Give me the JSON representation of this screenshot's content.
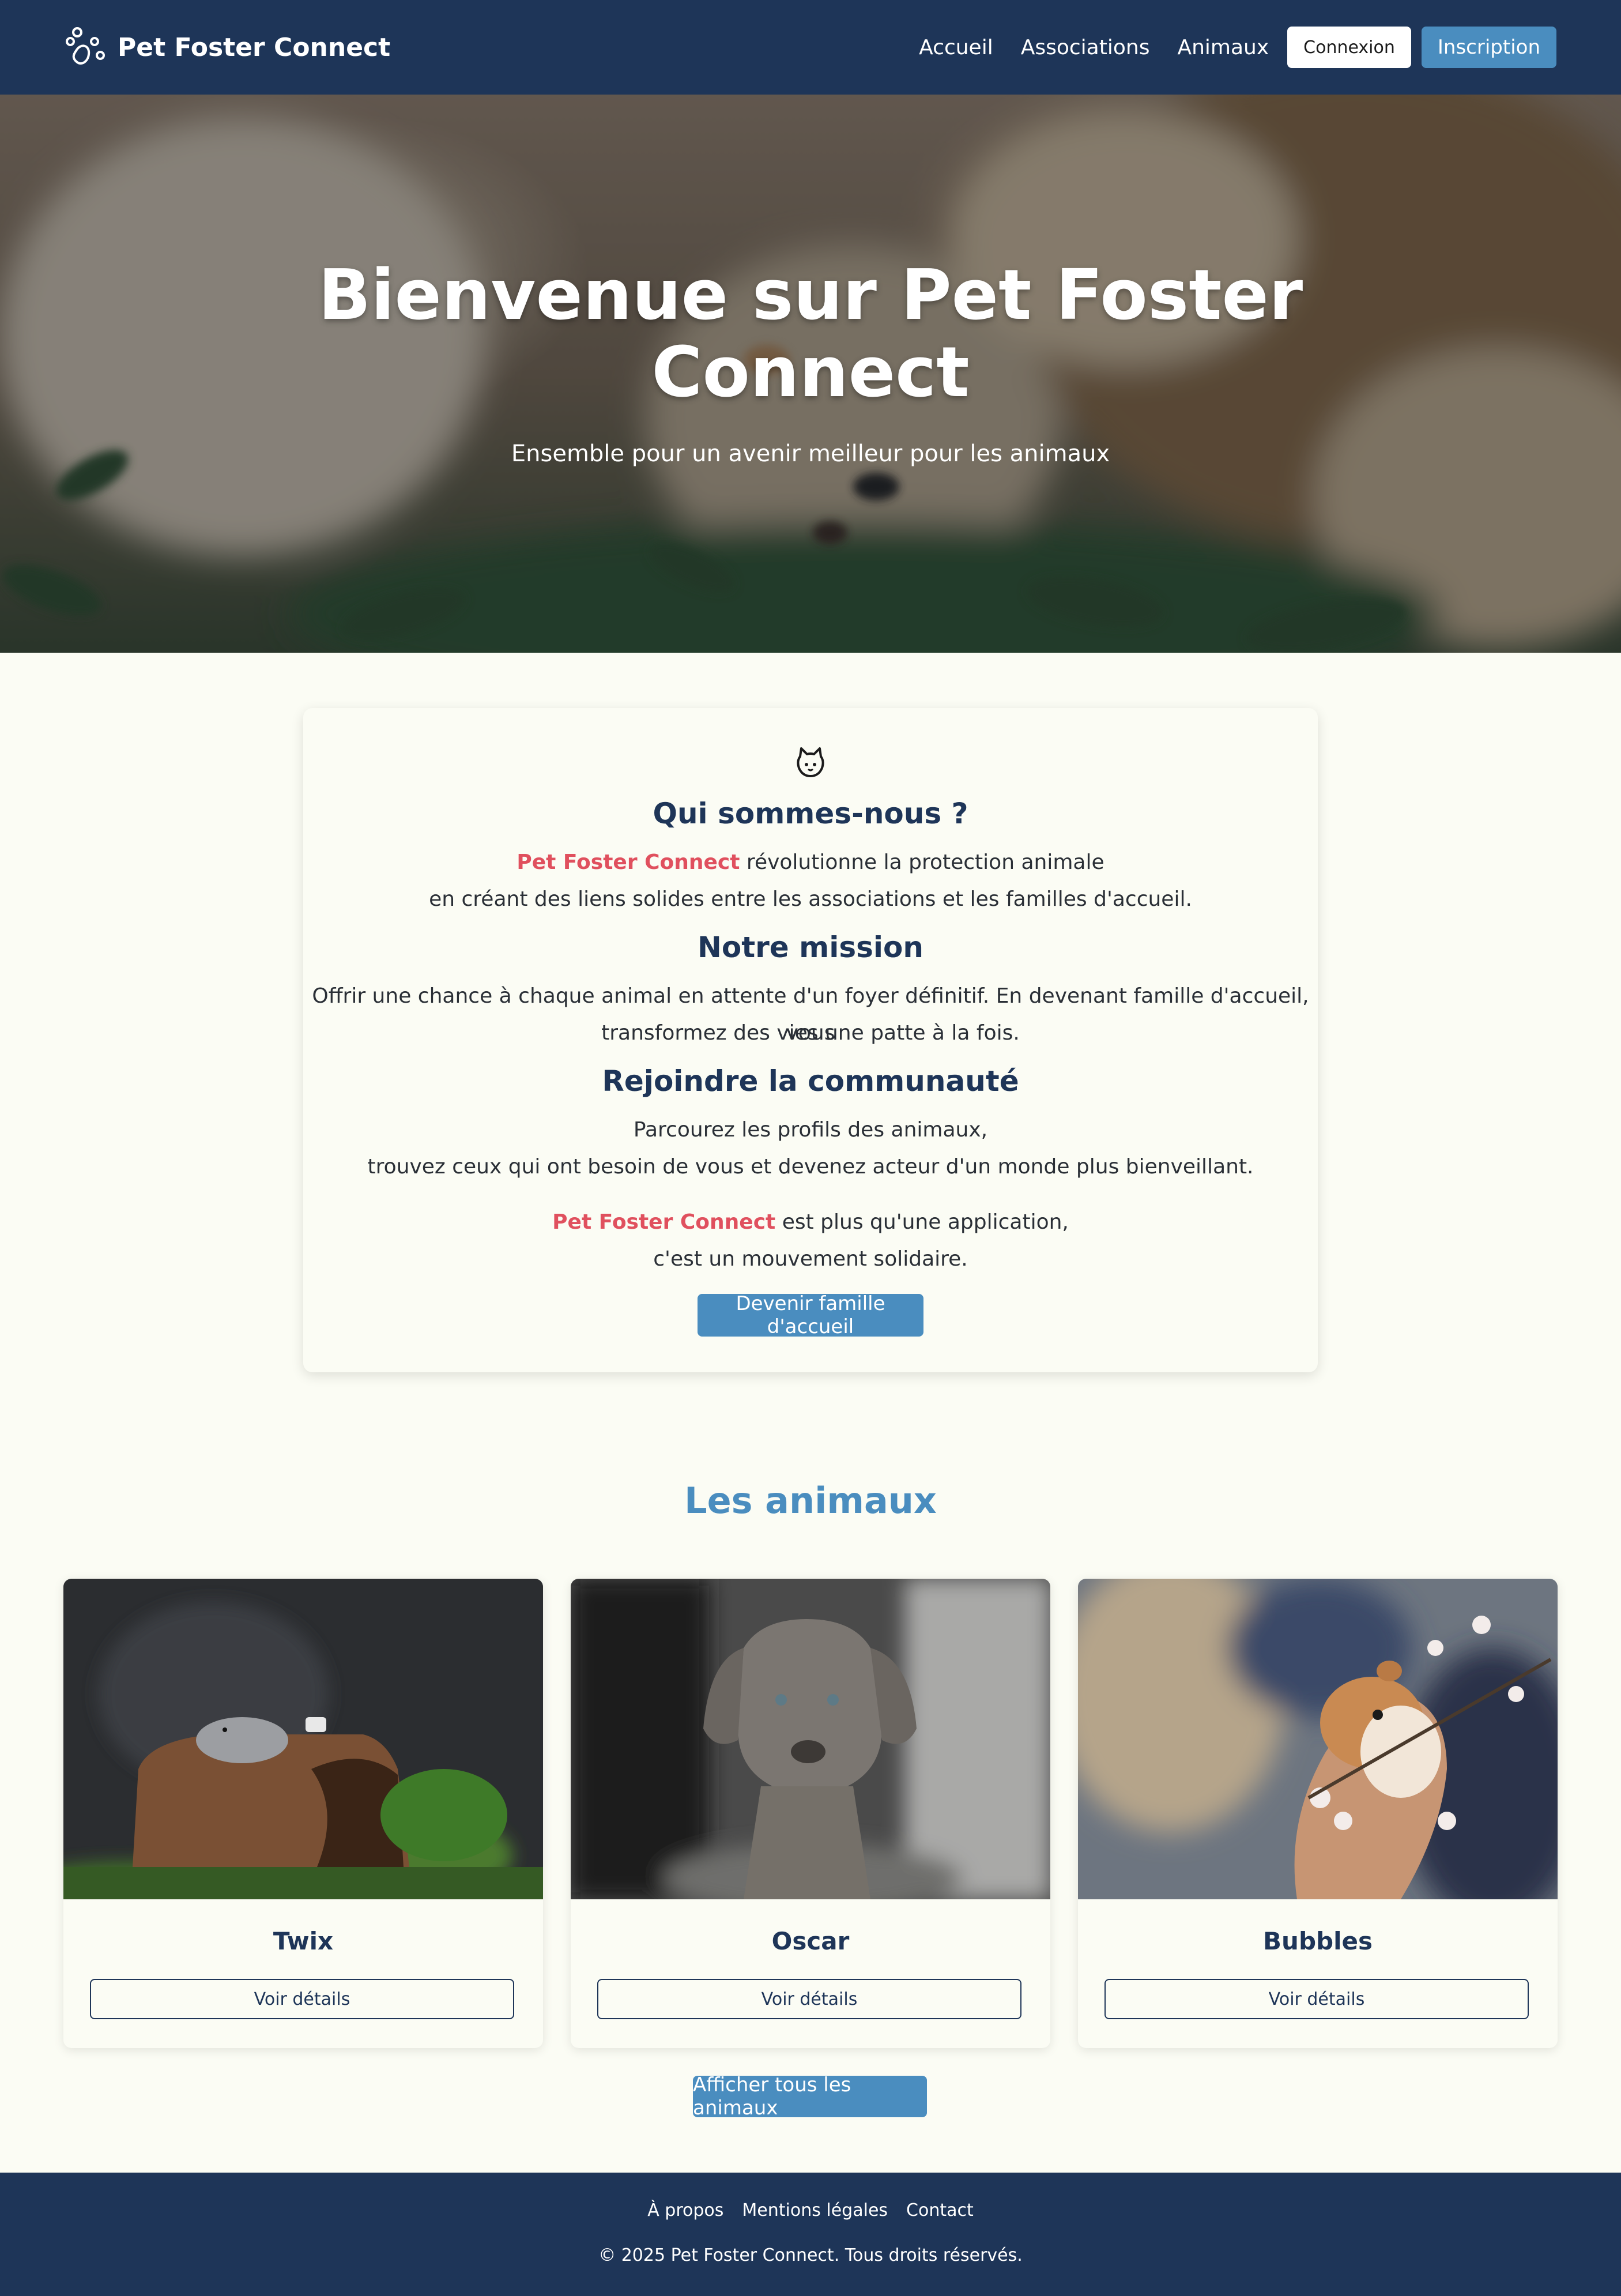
{
  "navbar": {
    "brand": "Pet Foster Connect",
    "brand_icon": "paw-icon",
    "links": [
      "Accueil",
      "Associations",
      "Animaux"
    ],
    "login_label": "Connexion",
    "signup_label": "Inscription"
  },
  "hero": {
    "title_line1": "Bienvenue sur Pet Foster",
    "title_line2": "Connect",
    "subtitle": "Ensemble pour un avenir meilleur pour les animaux"
  },
  "about": {
    "icon": "cat-icon",
    "who_title": "Qui sommes-nous ?",
    "who_brand": "Pet Foster Connect",
    "who_line1_rest": " révolutionne la protection animale",
    "who_line2": "en créant des liens solides entre les associations et les familles d'accueil.",
    "mission_title": "Notre mission",
    "mission_line1": "Offrir une chance à chaque animal en attente d'un foyer définitif. En devenant famille d'accueil, vous",
    "mission_line2": "transformez des vies une patte à la fois.",
    "community_title": "Rejoindre la communauté",
    "community_line1": "Parcourez les profils des animaux,",
    "community_line2": "trouvez ceux qui ont besoin de vous et devenez acteur d'un monde plus bienveillant.",
    "closing_brand": "Pet Foster Connect",
    "closing_line1_rest": " est plus qu'une application,",
    "closing_line2": "c'est un mouvement solidaire.",
    "cta_label": "Devenir famille d'accueil"
  },
  "animals": {
    "title": "Les animaux",
    "items": [
      {
        "name": "Twix",
        "button": "Voir détails"
      },
      {
        "name": "Oscar",
        "button": "Voir détails"
      },
      {
        "name": "Bubbles",
        "button": "Voir détails"
      }
    ],
    "show_all_label": "Afficher tous les animaux"
  },
  "footer": {
    "links": [
      "À propos",
      "Mentions légales",
      "Contact"
    ],
    "copyright": "© 2025 Pet Foster Connect. Tous droits réservés."
  },
  "colors": {
    "navy": "#1e3558",
    "accent_blue": "#4a8dbf",
    "brand_red": "#e0505e",
    "background": "#fbfcf4"
  }
}
